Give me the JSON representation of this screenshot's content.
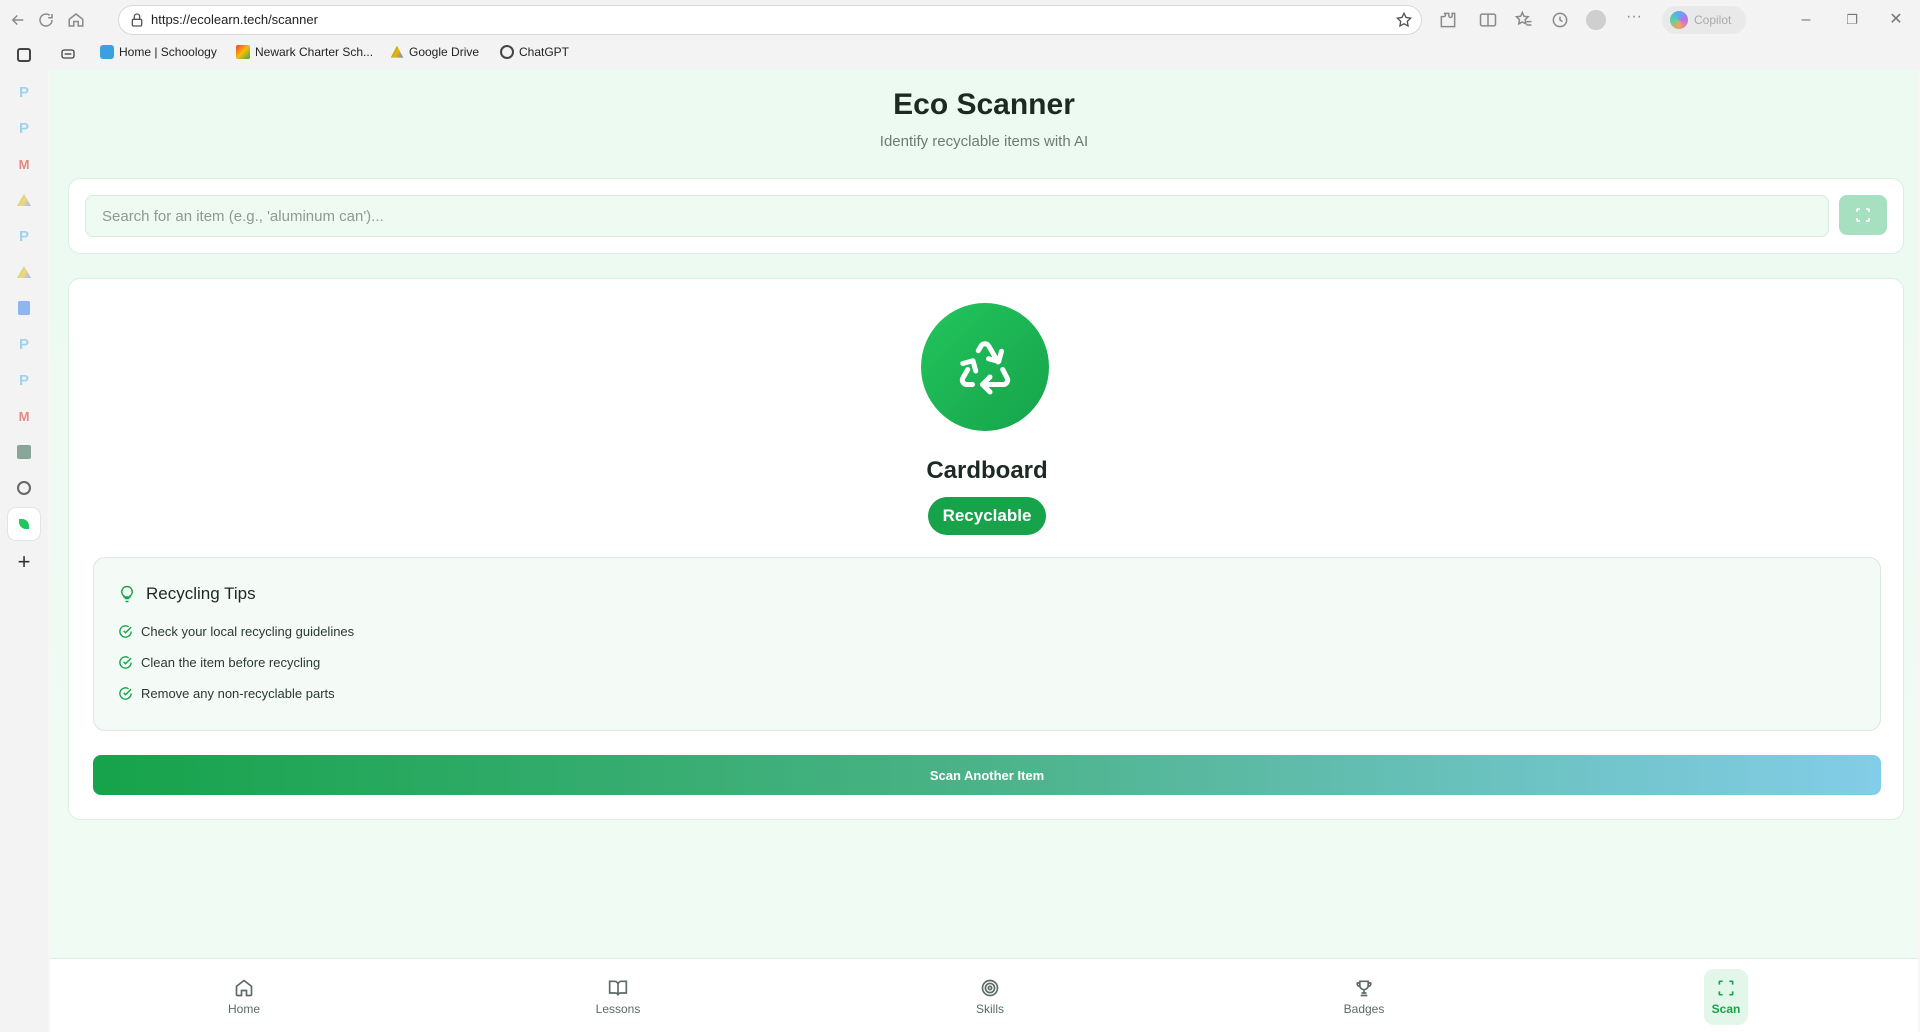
{
  "browser": {
    "url": "https://ecolearn.tech/scanner",
    "copilot_label": "Copilot",
    "bookmarks": [
      {
        "label": "Home | Schoology"
      },
      {
        "label": "Newark Charter Sch..."
      },
      {
        "label": "Google Drive"
      },
      {
        "label": "ChatGPT"
      }
    ]
  },
  "page": {
    "title": "Eco Scanner",
    "subtitle": "Identify recyclable items with AI"
  },
  "search": {
    "placeholder": "Search for an item (e.g., 'aluminum can')...",
    "value": ""
  },
  "result": {
    "item_name": "Cardboard",
    "status": "Recyclable",
    "status_color": "#16a34a",
    "icon": "recycle-icon"
  },
  "tips": {
    "heading": "Recycling Tips",
    "items": [
      "Check your local recycling guidelines",
      "Clean the item before recycling",
      "Remove any non-recyclable parts"
    ]
  },
  "actions": {
    "scan_another": "Scan Another Item"
  },
  "bottom_nav": {
    "items": [
      {
        "label": "Home",
        "icon": "home-icon"
      },
      {
        "label": "Lessons",
        "icon": "book-icon"
      },
      {
        "label": "Skills",
        "icon": "target-icon"
      },
      {
        "label": "Badges",
        "icon": "trophy-icon"
      },
      {
        "label": "Scan",
        "icon": "scan-icon"
      }
    ],
    "active": "Scan"
  },
  "colors": {
    "accent": "#16a34a",
    "background": "#ecfaf1"
  }
}
